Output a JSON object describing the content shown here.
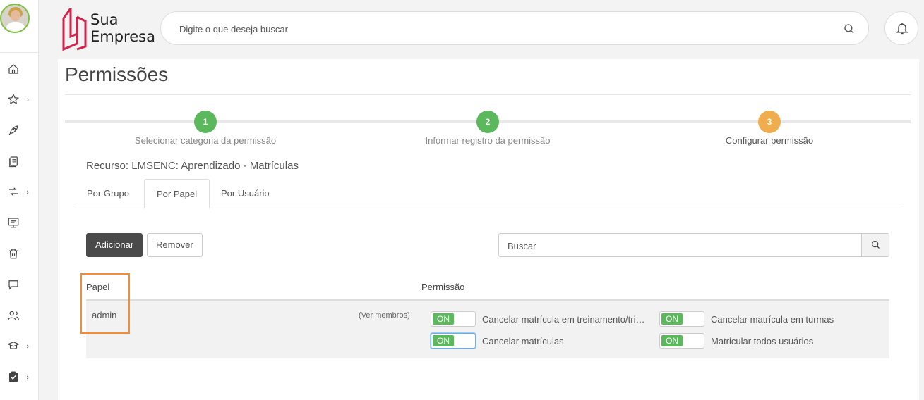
{
  "brand": {
    "line1": "Sua",
    "line2": "Empresa"
  },
  "topbar": {
    "search_placeholder": "Digite o que deseja buscar"
  },
  "sidebar": {
    "items": [
      "home-icon",
      "star-icon",
      "rocket-icon",
      "documents-icon",
      "arrows-icon",
      "presentation-icon",
      "trash-icon",
      "chat-icon",
      "users-icon",
      "graduation-icon",
      "clipboard-check-icon"
    ]
  },
  "page": {
    "title": "Permissões"
  },
  "steps": [
    {
      "number": "1",
      "label": "Selecionar categoria da permissão",
      "color": "#5cb85c"
    },
    {
      "number": "2",
      "label": "Informar registro da permissão",
      "color": "#5cb85c"
    },
    {
      "number": "3",
      "label": "Configurar permissão",
      "color": "#f0ad4e"
    }
  ],
  "resource": "Recurso: LMSENC: Aprendizado - Matrículas",
  "tabs": [
    "Por Grupo",
    "Por Papel",
    "Por Usuário"
  ],
  "active_tab": "Por Papel",
  "actions": {
    "add": "Adicionar",
    "remove": "Remover",
    "search_placeholder": "Buscar"
  },
  "table": {
    "headers": {
      "role": "Papel",
      "permission": "Permissão"
    },
    "rows": [
      {
        "role": "admin",
        "members_link": "(Ver membros)",
        "permissions": [
          {
            "state": "ON",
            "label": "Cancelar matrícula em treinamento/tri…"
          },
          {
            "state": "ON",
            "label": "Cancelar matrícula em turmas"
          },
          {
            "state": "ON",
            "label": "Cancelar matrículas"
          },
          {
            "state": "ON",
            "label": "Matricular todos usuários"
          }
        ]
      }
    ]
  }
}
